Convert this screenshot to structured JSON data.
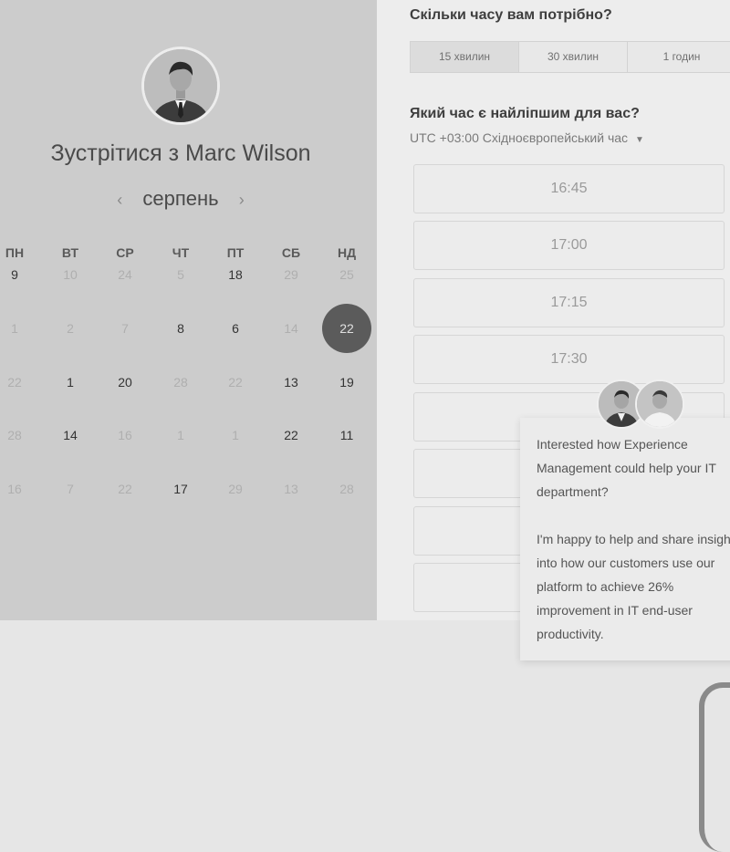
{
  "left": {
    "title": "Зустрітися з Marc Wilson",
    "month": "серпень",
    "prev_icon": "chevron-left-icon",
    "next_icon": "chevron-right-icon",
    "weekdays": [
      "ПН",
      "ВТ",
      "СР",
      "ЧТ",
      "ПТ",
      "СБ",
      "НД"
    ],
    "weeks": [
      [
        {
          "d": "9",
          "on": true
        },
        {
          "d": "10",
          "on": false
        },
        {
          "d": "24",
          "on": false
        },
        {
          "d": "5",
          "on": false
        },
        {
          "d": "18",
          "on": true
        },
        {
          "d": "29",
          "on": false
        },
        {
          "d": "25",
          "on": false
        }
      ],
      [
        {
          "d": "1",
          "on": false
        },
        {
          "d": "2",
          "on": false
        },
        {
          "d": "7",
          "on": false
        },
        {
          "d": "8",
          "on": true
        },
        {
          "d": "6",
          "on": true
        },
        {
          "d": "14",
          "on": false
        },
        {
          "d": "22",
          "on": true,
          "selected": true
        }
      ],
      [
        {
          "d": "22",
          "on": false
        },
        {
          "d": "1",
          "on": true
        },
        {
          "d": "20",
          "on": true
        },
        {
          "d": "28",
          "on": false
        },
        {
          "d": "22",
          "on": false
        },
        {
          "d": "13",
          "on": true
        },
        {
          "d": "19",
          "on": true
        }
      ],
      [
        {
          "d": "28",
          "on": false
        },
        {
          "d": "14",
          "on": true
        },
        {
          "d": "16",
          "on": false
        },
        {
          "d": "1",
          "on": false
        },
        {
          "d": "1",
          "on": false
        },
        {
          "d": "22",
          "on": true
        },
        {
          "d": "11",
          "on": true
        }
      ],
      [
        {
          "d": "16",
          "on": false
        },
        {
          "d": "7",
          "on": false
        },
        {
          "d": "22",
          "on": false
        },
        {
          "d": "17",
          "on": true
        },
        {
          "d": "29",
          "on": false
        },
        {
          "d": "13",
          "on": false
        },
        {
          "d": "28",
          "on": false
        }
      ]
    ]
  },
  "right": {
    "duration_title": "Скільки часу вам потрібно?",
    "durations": [
      "15 хвилин",
      "30 хвилин",
      "1 годин"
    ],
    "time_title": "Який час є найліпшим для вас?",
    "timezone": "UTC +03:00 Східноєвропейський час",
    "timezone_icon": "caret-down-icon",
    "slots": [
      "16:45",
      "17:00",
      "17:15",
      "17:30",
      "",
      "",
      "",
      ""
    ]
  },
  "chat": {
    "message": "Interested how Experience Management could help your IT department?\n\nI'm happy to help and share insight into how our customers use our platform to achieve 26% improvement in IT end-user productivity."
  }
}
